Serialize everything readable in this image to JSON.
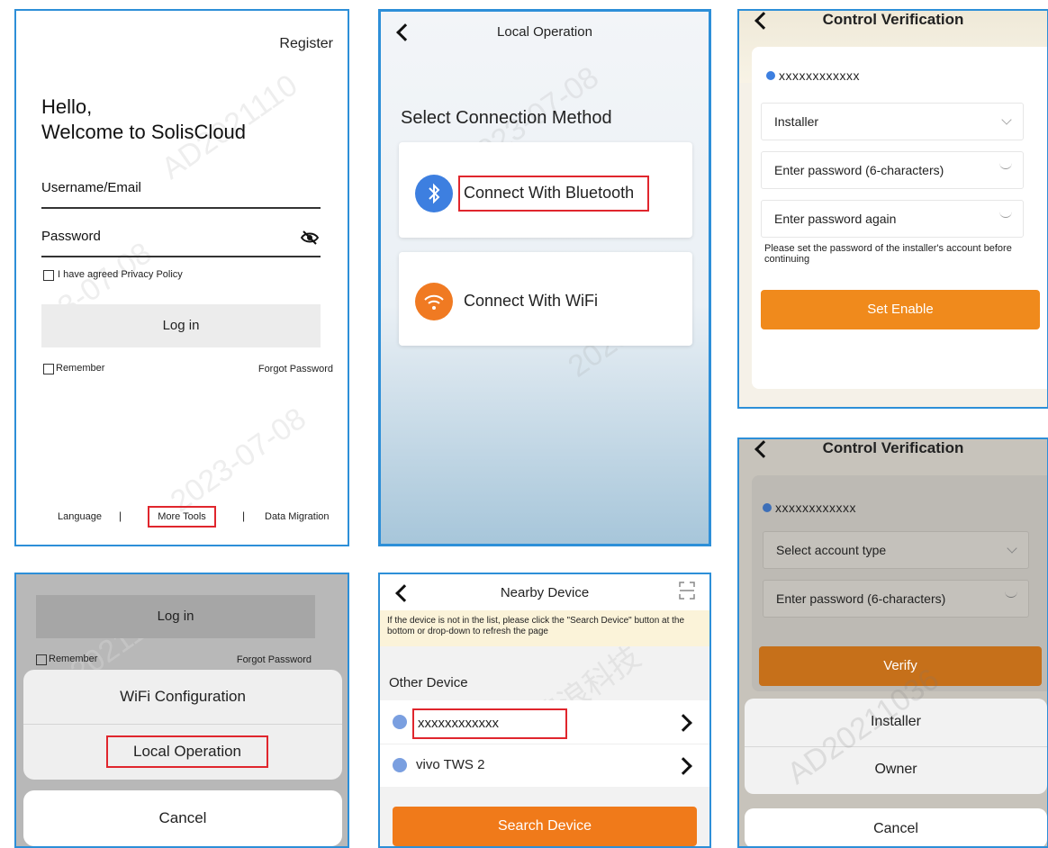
{
  "login_screen": {
    "register_link": "Register",
    "greeting_line1": "Hello,",
    "greeting_line2": "Welcome to SolisCloud",
    "username_label": "Username/Email",
    "password_label": "Password",
    "privacy_checkbox_label": "I have agreed Privacy Policy",
    "login_button": "Log in",
    "remember_label": "Remember",
    "forgot_password": "Forgot Password",
    "footer": {
      "language": "Language",
      "separator": "|",
      "more_tools": "More Tools",
      "data_migration": "Data Migration"
    }
  },
  "local_operation_screen": {
    "title": "Local Operation",
    "section_title": "Select Connection Method",
    "bluetooth_option": "Connect With Bluetooth",
    "wifi_option": "Connect With WiFi",
    "colors": {
      "bluetooth": "#3d7fe0",
      "wifi": "#f07a22"
    }
  },
  "control_verification_top": {
    "title": "Control Verification",
    "device_id": "xxxxxxxxxxxx",
    "account_type_value": "Installer",
    "password_placeholder": "Enter password (6-characters)",
    "password_again_placeholder": "Enter password again",
    "hint": "Please set the password of the installer's account before continuing",
    "button": "Set Enable"
  },
  "more_tools_sheet_screen": {
    "login_button": "Log in",
    "remember_label": "Remember",
    "forgot_password": "Forgot Password",
    "options": [
      "WiFi Configuration",
      "Local Operation"
    ],
    "cancel": "Cancel"
  },
  "nearby_device_screen": {
    "title": "Nearby Device",
    "notice": "If the device is not in the list, please click the \"Search Device\" button at the bottom or drop-down to refresh the page",
    "section_title": "Other Device",
    "devices": [
      {
        "name": "xxxxxxxxxxxx"
      },
      {
        "name": "vivo TWS 2"
      }
    ],
    "search_button": "Search Device"
  },
  "control_verification_bottom": {
    "title": "Control Verification",
    "device_id": "xxxxxxxxxxxx",
    "account_type_placeholder": "Select account type",
    "password_placeholder": "Enter password (6-characters)",
    "verify_button": "Verify",
    "sheet_options": [
      "Installer",
      "Owner"
    ],
    "cancel": "Cancel"
  },
  "colors": {
    "accent_orange": "#f08a1c",
    "highlight_red": "#e0262d",
    "panel_border": "#2d8fd8"
  }
}
